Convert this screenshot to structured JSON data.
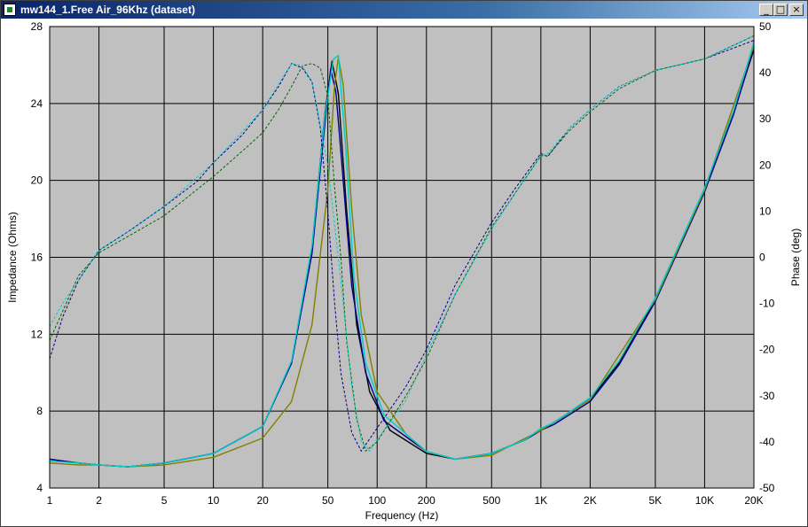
{
  "window": {
    "title": "mw144_1.Free Air_96Khz (dataset)"
  },
  "colors": {
    "plot_bg": "#c0c0c0",
    "grid": "#000000",
    "window_bg": "#ffffff"
  },
  "chart_data": {
    "type": "line",
    "xlabel": "Frequency (Hz)",
    "ylabel_left": "Impedance (Ohms)",
    "ylabel_right": "Phase (deg)",
    "x_scale": "log",
    "xlim": [
      1,
      20000
    ],
    "ylim_left": [
      4,
      28
    ],
    "ylim_right": [
      -50,
      50
    ],
    "grid": true,
    "x_ticks": [
      {
        "v": 1,
        "label": "1"
      },
      {
        "v": 2,
        "label": "2"
      },
      {
        "v": 5,
        "label": "5"
      },
      {
        "v": 10,
        "label": "10"
      },
      {
        "v": 20,
        "label": "20"
      },
      {
        "v": 50,
        "label": "50"
      },
      {
        "v": 100,
        "label": "100"
      },
      {
        "v": 200,
        "label": "200"
      },
      {
        "v": 500,
        "label": "500"
      },
      {
        "v": 1000,
        "label": "1K"
      },
      {
        "v": 2000,
        "label": "2K"
      },
      {
        "v": 5000,
        "label": "5K"
      },
      {
        "v": 10000,
        "label": "10K"
      },
      {
        "v": 20000,
        "label": "20K"
      }
    ],
    "y_ticks_left": [
      4,
      8,
      12,
      16,
      20,
      24,
      28
    ],
    "y_ticks_right": [
      -50,
      -40,
      -30,
      -20,
      -10,
      0,
      10,
      20,
      30,
      40,
      50
    ],
    "series": [
      {
        "axis": "left",
        "color": "#000000",
        "dash": false,
        "points": [
          [
            1,
            5.5
          ],
          [
            1.5,
            5.3
          ],
          [
            2,
            5.2
          ],
          [
            3,
            5.1
          ],
          [
            5,
            5.3
          ],
          [
            10,
            5.8
          ],
          [
            20,
            7.2
          ],
          [
            30,
            10.5
          ],
          [
            40,
            16.5
          ],
          [
            48,
            23.5
          ],
          [
            53,
            26.2
          ],
          [
            58,
            24.5
          ],
          [
            65,
            18.5
          ],
          [
            75,
            12.5
          ],
          [
            90,
            9
          ],
          [
            120,
            7
          ],
          [
            200,
            5.8
          ],
          [
            300,
            5.5
          ],
          [
            500,
            5.8
          ],
          [
            800,
            6.5
          ],
          [
            1000,
            7
          ],
          [
            1200,
            7.4
          ],
          [
            2000,
            8.6
          ],
          [
            3000,
            10.5
          ],
          [
            5000,
            13.8
          ],
          [
            10000,
            19.5
          ],
          [
            15000,
            23.5
          ],
          [
            20000,
            26.8
          ]
        ]
      },
      {
        "axis": "left",
        "color": "#00008b",
        "dash": false,
        "points": [
          [
            1,
            5.5
          ],
          [
            1.5,
            5.3
          ],
          [
            2,
            5.2
          ],
          [
            3,
            5.1
          ],
          [
            5,
            5.3
          ],
          [
            10,
            5.8
          ],
          [
            20,
            7.2
          ],
          [
            30,
            10.5
          ],
          [
            40,
            16.2
          ],
          [
            48,
            23
          ],
          [
            52,
            25.8
          ],
          [
            56,
            24.6
          ],
          [
            60,
            21.5
          ],
          [
            70,
            14.5
          ],
          [
            85,
            10
          ],
          [
            110,
            7.5
          ],
          [
            200,
            5.9
          ],
          [
            300,
            5.5
          ],
          [
            500,
            5.8
          ],
          [
            800,
            6.5
          ],
          [
            1000,
            7
          ],
          [
            1200,
            7.3
          ],
          [
            2000,
            8.5
          ],
          [
            3000,
            10.4
          ],
          [
            5000,
            13.7
          ],
          [
            10000,
            19.4
          ],
          [
            15000,
            23.4
          ],
          [
            20000,
            26.9
          ]
        ]
      },
      {
        "axis": "left",
        "color": "#808000",
        "dash": false,
        "points": [
          [
            1,
            5.3
          ],
          [
            1.5,
            5.2
          ],
          [
            2,
            5.2
          ],
          [
            3,
            5.1
          ],
          [
            5,
            5.2
          ],
          [
            10,
            5.6
          ],
          [
            20,
            6.6
          ],
          [
            30,
            8.5
          ],
          [
            40,
            12.5
          ],
          [
            50,
            19.5
          ],
          [
            55,
            25
          ],
          [
            58,
            26.4
          ],
          [
            62,
            25
          ],
          [
            70,
            18.5
          ],
          [
            80,
            13
          ],
          [
            100,
            9
          ],
          [
            150,
            6.8
          ],
          [
            200,
            5.9
          ],
          [
            300,
            5.5
          ],
          [
            500,
            5.7
          ],
          [
            1000,
            7
          ],
          [
            2000,
            8.6
          ],
          [
            5000,
            13.8
          ],
          [
            10000,
            19.5
          ],
          [
            20000,
            27
          ]
        ]
      },
      {
        "axis": "left",
        "color": "#00cccc",
        "dash": false,
        "points": [
          [
            1,
            5.4
          ],
          [
            1.5,
            5.3
          ],
          [
            2,
            5.2
          ],
          [
            3,
            5.1
          ],
          [
            5,
            5.3
          ],
          [
            10,
            5.8
          ],
          [
            20,
            7.2
          ],
          [
            30,
            10.6
          ],
          [
            40,
            16.6
          ],
          [
            48,
            23.4
          ],
          [
            54,
            26.3
          ],
          [
            58,
            26.5
          ],
          [
            64,
            22
          ],
          [
            72,
            15
          ],
          [
            85,
            10.5
          ],
          [
            110,
            7.8
          ],
          [
            200,
            5.9
          ],
          [
            300,
            5.5
          ],
          [
            500,
            5.8
          ],
          [
            800,
            6.5
          ],
          [
            1000,
            7.1
          ],
          [
            1200,
            7.4
          ],
          [
            2000,
            8.7
          ],
          [
            3000,
            10.6
          ],
          [
            5000,
            13.9
          ],
          [
            10000,
            19.6
          ],
          [
            15000,
            23.6
          ],
          [
            20000,
            27.2
          ]
        ]
      },
      {
        "axis": "right",
        "color": "#00008b",
        "dash": true,
        "points": [
          [
            1,
            -22
          ],
          [
            1.2,
            -13
          ],
          [
            1.5,
            -5
          ],
          [
            2,
            1.5
          ],
          [
            3,
            5.5
          ],
          [
            5,
            11
          ],
          [
            8,
            16.5
          ],
          [
            10,
            20.5
          ],
          [
            15,
            26.5
          ],
          [
            20,
            32
          ],
          [
            25,
            37
          ],
          [
            30,
            42
          ],
          [
            35,
            41
          ],
          [
            40,
            38
          ],
          [
            45,
            28
          ],
          [
            50,
            10
          ],
          [
            55,
            -10
          ],
          [
            60,
            -25
          ],
          [
            70,
            -38
          ],
          [
            80,
            -42
          ],
          [
            100,
            -37
          ],
          [
            150,
            -28
          ],
          [
            200,
            -20
          ],
          [
            300,
            -6
          ],
          [
            500,
            7.5
          ],
          [
            700,
            15
          ],
          [
            1000,
            22.5
          ],
          [
            1100,
            21.8
          ],
          [
            1500,
            28
          ],
          [
            2000,
            32
          ],
          [
            3000,
            37
          ],
          [
            5000,
            40.5
          ],
          [
            10000,
            43
          ],
          [
            20000,
            47
          ]
        ]
      },
      {
        "axis": "right",
        "color": "#006600",
        "dash": true,
        "points": [
          [
            1,
            -18
          ],
          [
            1.5,
            -4
          ],
          [
            2,
            1
          ],
          [
            3,
            4.5
          ],
          [
            5,
            9
          ],
          [
            10,
            17.5
          ],
          [
            15,
            23
          ],
          [
            20,
            27
          ],
          [
            25,
            32
          ],
          [
            30,
            37
          ],
          [
            35,
            41.5
          ],
          [
            40,
            42
          ],
          [
            45,
            41
          ],
          [
            50,
            35
          ],
          [
            55,
            15
          ],
          [
            60,
            0
          ],
          [
            65,
            -18
          ],
          [
            75,
            -35
          ],
          [
            85,
            -42
          ],
          [
            100,
            -40
          ],
          [
            150,
            -30
          ],
          [
            200,
            -22
          ],
          [
            300,
            -8
          ],
          [
            500,
            6.5
          ],
          [
            700,
            14
          ],
          [
            1000,
            22
          ],
          [
            1100,
            22
          ],
          [
            1500,
            27.5
          ],
          [
            2000,
            31.5
          ],
          [
            3000,
            36.5
          ],
          [
            5000,
            40.5
          ],
          [
            10000,
            43
          ],
          [
            20000,
            48
          ]
        ]
      },
      {
        "axis": "right",
        "color": "#00cccc",
        "dash": true,
        "points": [
          [
            1,
            -15
          ],
          [
            1.2,
            -10
          ],
          [
            1.5,
            -5
          ],
          [
            2,
            1.5
          ],
          [
            3,
            5.5
          ],
          [
            5,
            11
          ],
          [
            10,
            20.5
          ],
          [
            20,
            32
          ],
          [
            30,
            42
          ],
          [
            35,
            41.5
          ],
          [
            40,
            38
          ],
          [
            50,
            20
          ],
          [
            60,
            -5
          ],
          [
            70,
            -28
          ],
          [
            80,
            -40
          ],
          [
            90,
            -42
          ],
          [
            100,
            -39.5
          ],
          [
            150,
            -31
          ],
          [
            200,
            -21
          ],
          [
            300,
            -8
          ],
          [
            500,
            6
          ],
          [
            700,
            14
          ],
          [
            1000,
            22
          ],
          [
            1100,
            22.5
          ],
          [
            1500,
            28
          ],
          [
            2000,
            32
          ],
          [
            3000,
            37
          ],
          [
            5000,
            40.5
          ],
          [
            10000,
            43
          ],
          [
            20000,
            48
          ]
        ]
      }
    ]
  }
}
